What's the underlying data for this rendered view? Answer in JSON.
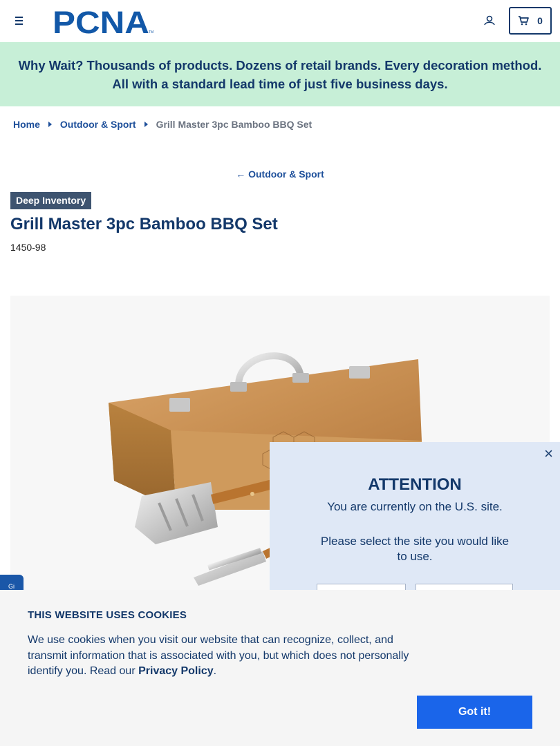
{
  "header": {
    "logo_text": "PCNA",
    "logo_tm": "TM",
    "cart_count": "0"
  },
  "promo": {
    "text": "Why Wait? Thousands of products. Dozens of retail brands. Every decoration method. All with a standard lead time of just five business days."
  },
  "breadcrumb": {
    "home": "Home",
    "category": "Outdoor & Sport",
    "current": "Grill Master 3pc Bamboo BBQ Set"
  },
  "back_link": {
    "arrow": "←",
    "label": "Outdoor & Sport"
  },
  "product": {
    "badge": "Deep Inventory",
    "title": "Grill Master 3pc Bamboo BBQ Set",
    "sku": "1450-98"
  },
  "feedback_tab": {
    "label": "Gi"
  },
  "attention_modal": {
    "close": "×",
    "title": "ATTENTION",
    "message1": "You are currently on the U.S. site.",
    "message2": "Please select the site you would like to use."
  },
  "cookie_banner": {
    "title": "THIS WEBSITE USES COOKIES",
    "body": "We use cookies when you visit our website that can recognize, collect, and transmit information that is associated with you, but which does not personally identify you. Read our ",
    "link": "Privacy Policy",
    "period": ".",
    "button": "Got it!"
  },
  "colors": {
    "brand_navy": "#13386a",
    "link_blue": "#1d4f9a",
    "promo_bg": "#c7efd7",
    "badge_bg": "#3e5470",
    "button_blue": "#1a65ea"
  }
}
